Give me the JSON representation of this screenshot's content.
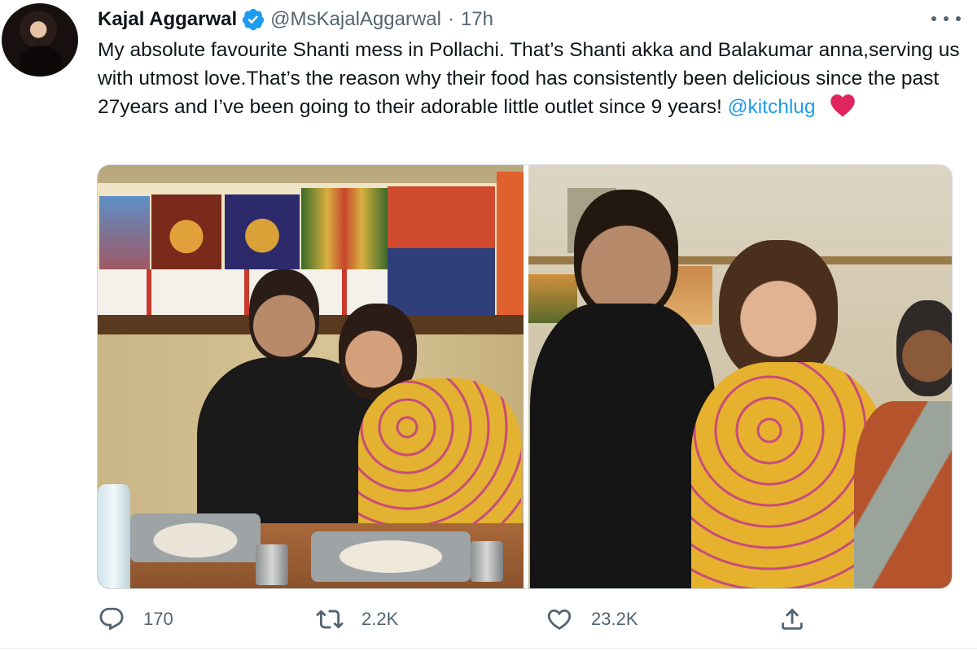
{
  "author": {
    "display_name": "Kajal Aggarwal",
    "handle": "@MsKajalAggarwal",
    "separator": "·",
    "time": "17h",
    "verified": true
  },
  "tweet": {
    "text": "My absolute favourite Shanti mess in Pollachi. That’s Shanti akka and Balakumar anna,serving us with utmost love.That’s the reason why their food has consistently been delicious since the past 27years and I’ve been going to their adorable little outlet since 9 years!",
    "mention": "@kitchlug",
    "emoji": "red-heart-icon"
  },
  "media": {
    "photos": [
      {
        "id": "left",
        "kind": "photo"
      },
      {
        "id": "right",
        "kind": "photo"
      }
    ]
  },
  "actions": {
    "reply_count": "170",
    "retweet_count": "2.2K",
    "like_count": "23.2K"
  },
  "colors": {
    "accent": "#1d9bf0",
    "text": "#0f1419",
    "muted": "#536471",
    "heart": "#e0245e"
  },
  "icons": {
    "more": "more-icon",
    "reply": "reply-icon",
    "retweet": "retweet-icon",
    "like": "like-icon",
    "share": "share-icon",
    "verified": "verified-badge-icon"
  }
}
